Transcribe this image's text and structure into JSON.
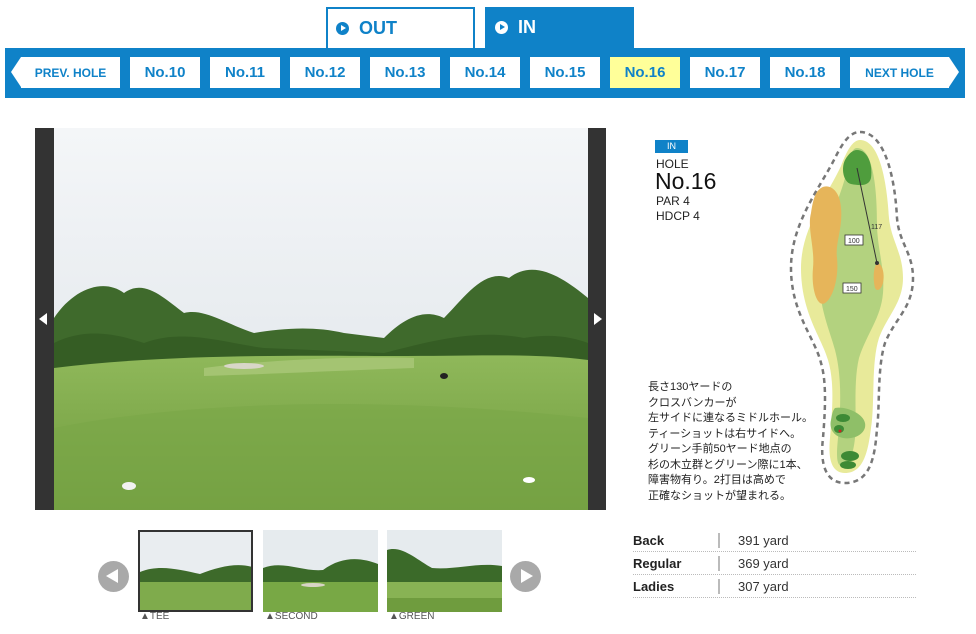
{
  "tabs": [
    {
      "label": "OUT"
    },
    {
      "label": "IN"
    }
  ],
  "nav": {
    "prev_label": "PREV. HOLE",
    "next_label": "NEXT HOLE",
    "holes": [
      "No.10",
      "No.11",
      "No.12",
      "No.13",
      "No.14",
      "No.15",
      "No.16",
      "No.17",
      "No.18"
    ],
    "active_hole": "No.16"
  },
  "hole": {
    "course_badge": "IN",
    "hole_label": "HOLE",
    "number": "No.16",
    "par": "PAR 4",
    "hdcp": "HDCP 4",
    "description": [
      "長さ130ヤードの",
      "クロスバンカーが",
      "左サイドに連なるミドルホール。",
      "ティーショットは右サイドへ。",
      "グリーン手前50ヤード地点の",
      "杉の木立群とグリーン際に1本、",
      "障害物有り。2打目は高めで",
      "正確なショットが望まれる。"
    ],
    "map_labels": {
      "marker_100": "100",
      "marker_150": "150",
      "distance": "117"
    }
  },
  "thumbnails": [
    {
      "label": "▲TEE"
    },
    {
      "label": "▲SECOND"
    },
    {
      "label": "▲GREEN"
    }
  ],
  "yardage": [
    {
      "name": "Back",
      "value": "391 yard"
    },
    {
      "name": "Regular",
      "value": "369 yard"
    },
    {
      "name": "Ladies",
      "value": "307 yard"
    }
  ],
  "colors": {
    "accent": "#0f82c8",
    "active_hole_bg": "#ffff99",
    "viewer_frame": "#333333"
  }
}
